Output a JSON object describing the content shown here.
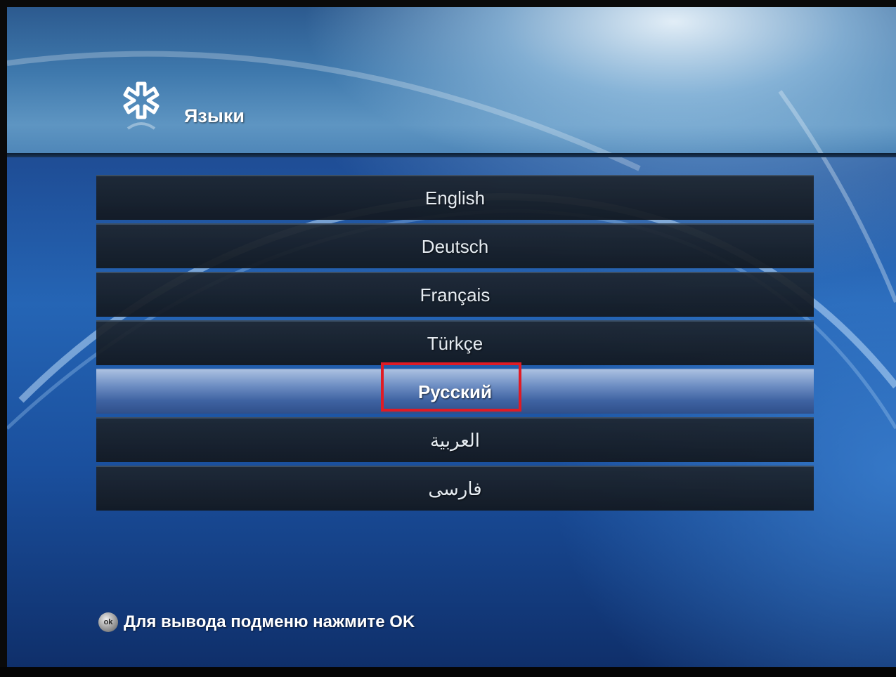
{
  "header": {
    "title": "Языки",
    "icon": "settings-asterisk-icon"
  },
  "menu": {
    "items": [
      {
        "label": "English",
        "selected": false
      },
      {
        "label": "Deutsch",
        "selected": false
      },
      {
        "label": "Français",
        "selected": false
      },
      {
        "label": "Türkçe",
        "selected": false
      },
      {
        "label": "Русский",
        "selected": true
      },
      {
        "label": "العربية",
        "selected": false
      },
      {
        "label": "فارسی",
        "selected": false
      }
    ]
  },
  "footer": {
    "ok_icon_label": "ok",
    "hint": "Для вывода подменю нажмите OK"
  },
  "colors": {
    "highlight_border": "#e01b24",
    "selected_row": "#4f72ad",
    "row": "#1a2129",
    "background": "#1f4f98"
  }
}
